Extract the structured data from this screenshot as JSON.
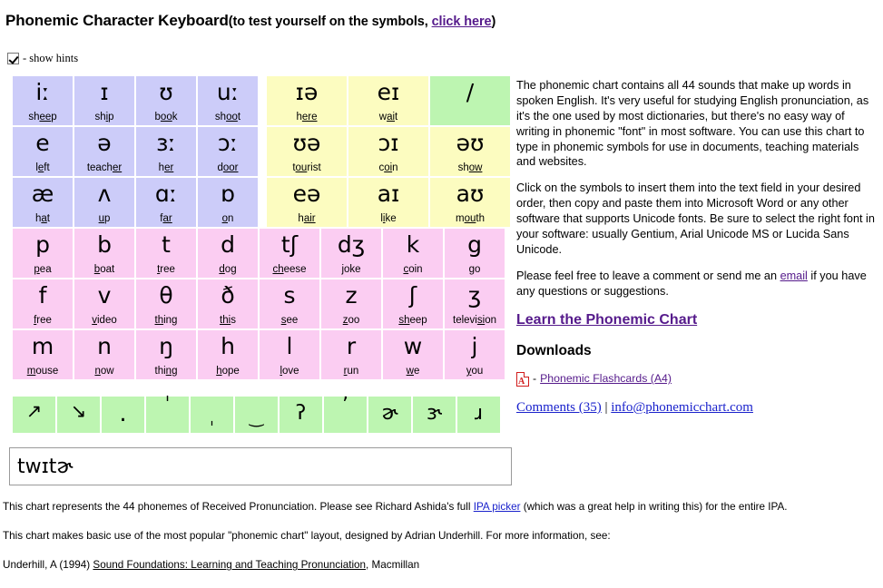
{
  "header": {
    "title_main": "Phonemic Character Keyboard",
    "title_paren_open": "(to test yourself on the symbols, ",
    "title_link": "click here",
    "title_paren_close": ")"
  },
  "hints": {
    "label": "- show hints",
    "checked": true
  },
  "keyboard": {
    "vowels": [
      [
        {
          "symbol": "iː",
          "hint_pre": "sh",
          "hint_mid": "ee",
          "hint_post": "p"
        },
        {
          "symbol": "ɪ",
          "hint_pre": "sh",
          "hint_mid": "i",
          "hint_post": "p"
        },
        {
          "symbol": "ʊ",
          "hint_pre": "b",
          "hint_mid": "oo",
          "hint_post": "k"
        },
        {
          "symbol": "uː",
          "hint_pre": "sh",
          "hint_mid": "oo",
          "hint_post": "t"
        }
      ],
      [
        {
          "symbol": "e",
          "hint_pre": "l",
          "hint_mid": "e",
          "hint_post": "ft"
        },
        {
          "symbol": "ə",
          "hint_pre": "teach",
          "hint_mid": "er",
          "hint_post": ""
        },
        {
          "symbol": "ɜː",
          "hint_pre": "h",
          "hint_mid": "er",
          "hint_post": ""
        },
        {
          "symbol": "ɔː",
          "hint_pre": "d",
          "hint_mid": "oor",
          "hint_post": ""
        }
      ],
      [
        {
          "symbol": "æ",
          "hint_pre": "h",
          "hint_mid": "a",
          "hint_post": "t"
        },
        {
          "symbol": "ʌ",
          "hint_pre": "",
          "hint_mid": "u",
          "hint_post": "p"
        },
        {
          "symbol": "ɑː",
          "hint_pre": "f",
          "hint_mid": "ar",
          "hint_post": ""
        },
        {
          "symbol": "ɒ",
          "hint_pre": "",
          "hint_mid": "o",
          "hint_post": "n"
        }
      ]
    ],
    "diphthongs": [
      [
        {
          "symbol": "ɪə",
          "hint_pre": "h",
          "hint_mid": "ere",
          "hint_post": "",
          "green": false
        },
        {
          "symbol": "eɪ",
          "hint_pre": "w",
          "hint_mid": "ai",
          "hint_post": "t",
          "green": false
        },
        {
          "symbol": "/",
          "hint_pre": "",
          "hint_mid": "",
          "hint_post": "",
          "green": true
        }
      ],
      [
        {
          "symbol": "ʊə",
          "hint_pre": "t",
          "hint_mid": "ou",
          "hint_post": "rist",
          "green": false
        },
        {
          "symbol": "ɔɪ",
          "hint_pre": "c",
          "hint_mid": "oi",
          "hint_post": "n",
          "green": false
        },
        {
          "symbol": "əʊ",
          "hint_pre": "sh",
          "hint_mid": "ow",
          "hint_post": "",
          "green": false
        }
      ],
      [
        {
          "symbol": "eə",
          "hint_pre": "h",
          "hint_mid": "air",
          "hint_post": "",
          "green": false
        },
        {
          "symbol": "aɪ",
          "hint_pre": "l",
          "hint_mid": "i",
          "hint_post": "ke",
          "green": false
        },
        {
          "symbol": "aʊ",
          "hint_pre": "m",
          "hint_mid": "ou",
          "hint_post": "th",
          "green": false
        }
      ]
    ],
    "consonants": [
      [
        {
          "symbol": "p",
          "hint_pre": "",
          "hint_mid": "p",
          "hint_post": "ea"
        },
        {
          "symbol": "b",
          "hint_pre": "",
          "hint_mid": "b",
          "hint_post": "oat"
        },
        {
          "symbol": "t",
          "hint_pre": "",
          "hint_mid": "t",
          "hint_post": "ree"
        },
        {
          "symbol": "d",
          "hint_pre": "",
          "hint_mid": "d",
          "hint_post": "og"
        },
        {
          "symbol": "tʃ",
          "hint_pre": "",
          "hint_mid": "ch",
          "hint_post": "eese"
        },
        {
          "symbol": "dʒ",
          "hint_pre": "",
          "hint_mid": "j",
          "hint_post": "oke"
        },
        {
          "symbol": "k",
          "hint_pre": "",
          "hint_mid": "c",
          "hint_post": "oin"
        },
        {
          "symbol": "g",
          "hint_pre": "",
          "hint_mid": "g",
          "hint_post": "o"
        }
      ],
      [
        {
          "symbol": "f",
          "hint_pre": "",
          "hint_mid": "f",
          "hint_post": "ree"
        },
        {
          "symbol": "v",
          "hint_pre": "",
          "hint_mid": "v",
          "hint_post": "ideo"
        },
        {
          "symbol": "θ",
          "hint_pre": "",
          "hint_mid": "th",
          "hint_post": "ing"
        },
        {
          "symbol": "ð",
          "hint_pre": "",
          "hint_mid": "thi",
          "hint_post": "s"
        },
        {
          "symbol": "s",
          "hint_pre": "",
          "hint_mid": "s",
          "hint_post": "ee"
        },
        {
          "symbol": "z",
          "hint_pre": "",
          "hint_mid": "z",
          "hint_post": "oo"
        },
        {
          "symbol": "ʃ",
          "hint_pre": "",
          "hint_mid": "sh",
          "hint_post": "eep"
        },
        {
          "symbol": "ʒ",
          "hint_pre": "televi",
          "hint_mid": "si",
          "hint_post": "on"
        }
      ],
      [
        {
          "symbol": "m",
          "hint_pre": "",
          "hint_mid": "m",
          "hint_post": "ouse"
        },
        {
          "symbol": "n",
          "hint_pre": "",
          "hint_mid": "n",
          "hint_post": "ow"
        },
        {
          "symbol": "ŋ",
          "hint_pre": "thi",
          "hint_mid": "ng",
          "hint_post": ""
        },
        {
          "symbol": "h",
          "hint_pre": "",
          "hint_mid": "h",
          "hint_post": "ope"
        },
        {
          "symbol": "l",
          "hint_pre": "",
          "hint_mid": "l",
          "hint_post": "ove"
        },
        {
          "symbol": "r",
          "hint_pre": "",
          "hint_mid": "r",
          "hint_post": "un"
        },
        {
          "symbol": "w",
          "hint_pre": "",
          "hint_mid": "w",
          "hint_post": "e"
        },
        {
          "symbol": "j",
          "hint_pre": "",
          "hint_mid": "y",
          "hint_post": "ou"
        }
      ]
    ],
    "diacritics": [
      {
        "symbol": "↗",
        "name": "rising-intonation",
        "style": "d-arrow"
      },
      {
        "symbol": "↘",
        "name": "falling-intonation",
        "style": "d-arrow"
      },
      {
        "symbol": ".",
        "name": "syllable-break",
        "style": "d-dot"
      },
      {
        "symbol": "ˈ",
        "name": "primary-stress",
        "style": "d-high"
      },
      {
        "symbol": "ˌ",
        "name": "secondary-stress",
        "style": "d-low"
      },
      {
        "symbol": "‿",
        "name": "linking-tie",
        "style": "d-low"
      },
      {
        "symbol": "ʔ",
        "name": "glottal-stop",
        "style": "d-mid"
      },
      {
        "symbol": "ʼ",
        "name": "ejective-apostrophe",
        "style": "d-high"
      },
      {
        "symbol": "ɚ",
        "name": "r-coloured-schwa",
        "style": "d-mid"
      },
      {
        "symbol": "ɝ",
        "name": "r-coloured-open-e",
        "style": "d-mid"
      },
      {
        "symbol": "ɹ",
        "name": "turned-r",
        "style": "d-mid"
      }
    ]
  },
  "output": {
    "value": "twɪtɚ",
    "placeholder": ""
  },
  "info": {
    "para1": "The phonemic chart contains all 44 sounds that make up words in spoken English. It's very useful for studying English pronunciation, as it's the one used by most dictionaries, but there's no easy way of writing in phonemic \"font\" in most software. You can use this chart to type in phonemic symbols for use in documents, teaching materials and websites.",
    "para2_before": "Click on the symbols to insert them into the text field in your desired order, then copy and paste them into Microsoft Word or any other software that supports Unicode fonts. Be sure to select the right font in your software: usually Gentium, Arial Unicode MS or Lucida Sans Unicode.",
    "para3_before": "Please feel free to leave a comment or send me an ",
    "para3_link": "email",
    "para3_after": " if you have any questions or suggestions.",
    "learn_link": "Learn the Phonemic Chart",
    "downloads_heading": "Downloads",
    "download_sep": "- ",
    "download_link": "Phonemic Flashcards (A4)",
    "comments_link": "Comments (35)",
    "comments_sep": " | ",
    "email_link": "info@phonemicchart.com"
  },
  "footer": {
    "line1_before": "This chart represents the 44 phonemes of Received Pronunciation. Please see Richard Ashida's full ",
    "line1_link": "IPA picker",
    "line1_after": " (which was a great help in writing this) for the entire IPA.",
    "line2": "This chart makes basic use of the most popular \"phonemic chart\" layout, designed by Adrian Underhill. For more information, see:",
    "line3_before": "Underhill, A (1994) ",
    "line3_title": "Sound Foundations: Learning and Teaching Pronunciation",
    "line3_after": ", Macmillan"
  },
  "colors": {
    "vowel_bg": "#ccccf9",
    "diphthong_bg": "#fcfcc0",
    "consonant_bg": "#fbcdf2",
    "diacritic_bg": "#bdf5b1",
    "link_purple": "#551a8b",
    "link_blue": "#1a22cc"
  }
}
